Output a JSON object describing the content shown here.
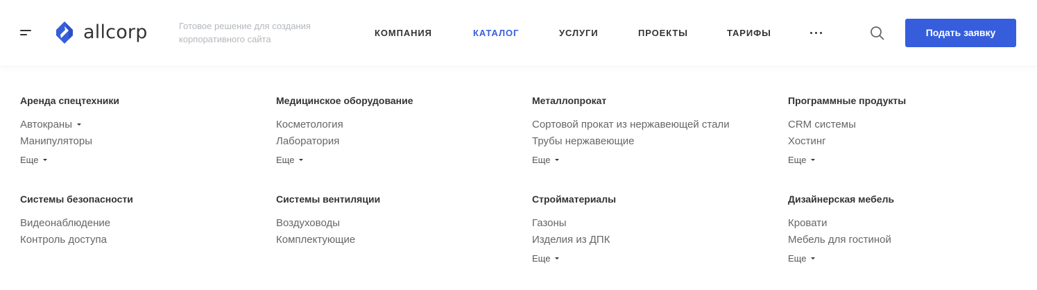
{
  "header": {
    "logo_text": "allcorp",
    "tagline": "Готовое решение для создания корпоративного сайта",
    "nav": [
      {
        "label": "КОМПАНИЯ",
        "active": false
      },
      {
        "label": "КАТАЛОГ",
        "active": true
      },
      {
        "label": "УСЛУГИ",
        "active": false
      },
      {
        "label": "ПРОЕКТЫ",
        "active": false
      },
      {
        "label": "ТАРИФЫ",
        "active": false
      }
    ],
    "more_icon": "more-dots-icon",
    "search_icon": "search-icon",
    "cta_label": "Подать заявку"
  },
  "colors": {
    "accent": "#365edc",
    "text": "#333333",
    "muted": "#b4b8bd"
  },
  "catalog": [
    {
      "title": "Аренда спецтехники",
      "items": [
        {
          "label": "Автокраны",
          "has_children": true
        },
        {
          "label": "Манипуляторы",
          "has_children": false
        }
      ],
      "more": "Еще"
    },
    {
      "title": "Медицинское оборудование",
      "items": [
        {
          "label": "Косметология",
          "has_children": false
        },
        {
          "label": "Лаборатория",
          "has_children": false
        }
      ],
      "more": "Еще"
    },
    {
      "title": "Металлопрокат",
      "items": [
        {
          "label": "Сортовой прокат из нержавеющей стали",
          "has_children": false
        },
        {
          "label": "Трубы нержавеющие",
          "has_children": false
        }
      ],
      "more": "Еще"
    },
    {
      "title": "Программные продукты",
      "items": [
        {
          "label": "CRM системы",
          "has_children": false
        },
        {
          "label": "Хостинг",
          "has_children": false
        }
      ],
      "more": "Еще"
    },
    {
      "title": "Системы безопасности",
      "items": [
        {
          "label": "Видеонаблюдение",
          "has_children": false
        },
        {
          "label": "Контроль доступа",
          "has_children": false
        }
      ],
      "more": null
    },
    {
      "title": "Системы вентиляции",
      "items": [
        {
          "label": "Воздуховоды",
          "has_children": false
        },
        {
          "label": "Комплектующие",
          "has_children": false
        }
      ],
      "more": null
    },
    {
      "title": "Стройматериалы",
      "items": [
        {
          "label": "Газоны",
          "has_children": false
        },
        {
          "label": "Изделия из ДПК",
          "has_children": false
        }
      ],
      "more": "Еще"
    },
    {
      "title": "Дизайнерская мебель",
      "items": [
        {
          "label": "Кровати",
          "has_children": false
        },
        {
          "label": "Мебель для гостиной",
          "has_children": false
        }
      ],
      "more": "Еще"
    }
  ]
}
